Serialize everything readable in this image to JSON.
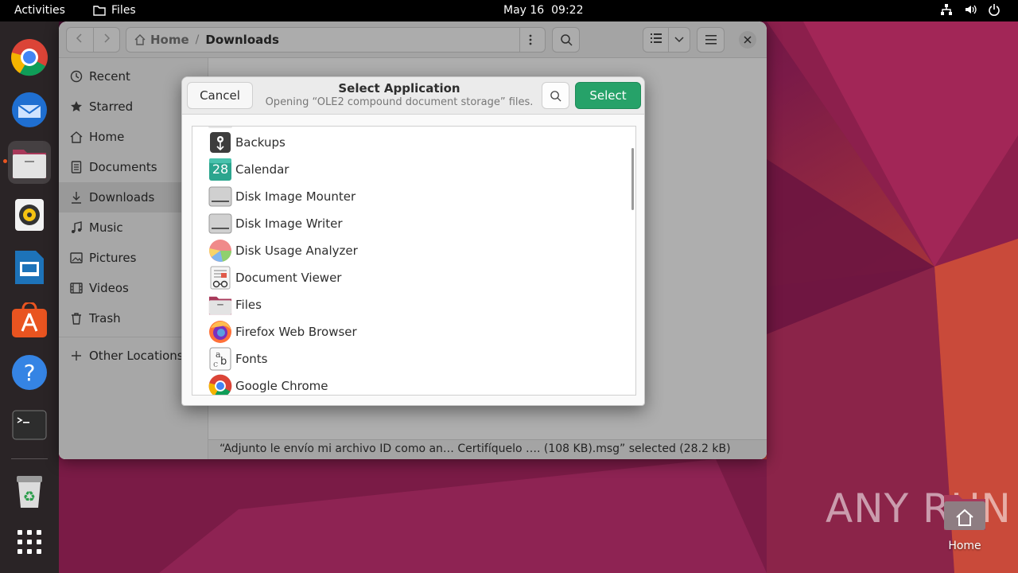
{
  "topbar": {
    "activities": "Activities",
    "app_name": "Files",
    "date": "May 16",
    "time": "09:22"
  },
  "dock": {
    "items": [
      "chrome-icon",
      "thunderbird-icon",
      "files-icon",
      "rhythmbox-icon",
      "libreoffice-impress-icon",
      "app-center-icon",
      "help-icon",
      "terminal-icon",
      "trash-icon",
      "show-apps-icon"
    ]
  },
  "files_window": {
    "path": {
      "home": "Home",
      "separator": "/",
      "current": "Downloads"
    },
    "sidebar": {
      "items": [
        {
          "label": "Recent",
          "icon": "clock-icon"
        },
        {
          "label": "Starred",
          "icon": "star-icon"
        },
        {
          "label": "Home",
          "icon": "home-icon"
        },
        {
          "label": "Documents",
          "icon": "document-icon"
        },
        {
          "label": "Downloads",
          "icon": "download-icon"
        },
        {
          "label": "Music",
          "icon": "music-icon"
        },
        {
          "label": "Pictures",
          "icon": "picture-icon"
        },
        {
          "label": "Videos",
          "icon": "video-icon"
        },
        {
          "label": "Trash",
          "icon": "trash-icon"
        }
      ],
      "other_locations": "Other Locations"
    },
    "status": "“Adjunto le envío mi archivo ID como an… Certifíquelo …. (108 KB).msg” selected (28.2 kB)"
  },
  "dialog": {
    "cancel": "Cancel",
    "title": "Select Application",
    "subtitle": "Opening “OLE2 compound document storage” files.",
    "select": "Select",
    "apps": [
      {
        "name": "Backups",
        "icon": "backups-icon"
      },
      {
        "name": "Calendar",
        "icon": "calendar-icon",
        "icon_text": "28"
      },
      {
        "name": "Disk Image Mounter",
        "icon": "disk-icon"
      },
      {
        "name": "Disk Image Writer",
        "icon": "disk-icon"
      },
      {
        "name": "Disk Usage Analyzer",
        "icon": "disk-usage-icon"
      },
      {
        "name": "Document Viewer",
        "icon": "document-viewer-icon"
      },
      {
        "name": "Files",
        "icon": "files-icon"
      },
      {
        "name": "Firefox Web Browser",
        "icon": "firefox-icon"
      },
      {
        "name": "Fonts",
        "icon": "fonts-icon"
      },
      {
        "name": "Google Chrome",
        "icon": "chrome-icon"
      }
    ]
  },
  "desktop": {
    "watermark": "ANY RUN",
    "home_label": "Home"
  },
  "colors": {
    "accent_green": "#26a269",
    "ubuntu_orange": "#e95420"
  }
}
